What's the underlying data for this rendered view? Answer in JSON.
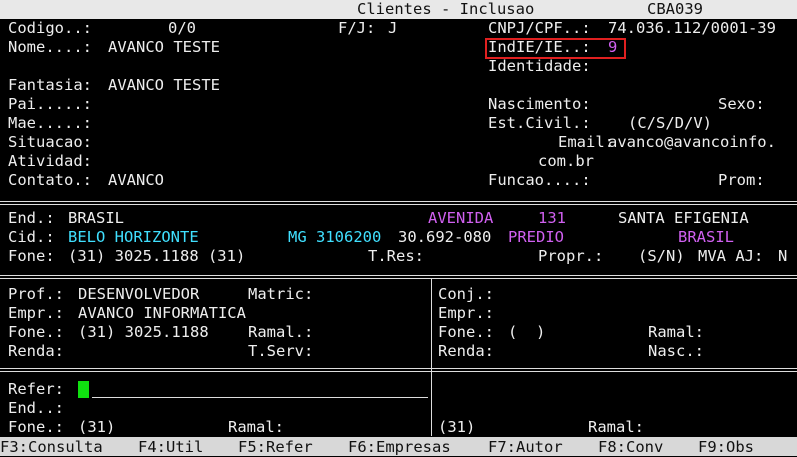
{
  "title": {
    "text": "Clientes - Inclusao",
    "code": "CBA039"
  },
  "header": {
    "codigo_label": "Codigo..:",
    "codigo_value": "0/0",
    "fj_label": "F/J:",
    "fj_value": "J",
    "cnpj_label": "CNPJ/CPF..:",
    "cnpj_value": "74.036.112/0001-39",
    "nome_label": "Nome....:",
    "nome_value": "AVANCO TESTE",
    "indie_label": "IndIE/IE..:",
    "indie_value": "9",
    "identidade_label": "Identidade:",
    "fantasia_label": "Fantasia:",
    "fantasia_value": "AVANCO TESTE",
    "pai_label": "Pai.....:",
    "nascimento_label": "Nascimento:",
    "sexo_label": "Sexo:",
    "mae_label": "Mae.....:",
    "estcivil_label": "Est.Civil.:",
    "estcivil_hint": "(C/S/D/V)",
    "situacao_label": "Situacao:",
    "email_label": "Email:",
    "email_value_1": "avanco@avancoinfo.",
    "email_value_2": "com.br",
    "atividade_label": "Atividad:",
    "contato_label": "Contato.:",
    "contato_value": "AVANCO",
    "funcao_label": "Funcao....:",
    "prom_label": "Prom:"
  },
  "address": {
    "end_label": "End.:",
    "end_value": "BRASIL",
    "tipo": "AVENIDA",
    "numero": "131",
    "bairro": "SANTA EFIGENIA",
    "cid_label": "Cid.:",
    "cid_value": "BELO HORIZONTE",
    "uf_ibge": "MG 3106200",
    "cep": "30.692-080",
    "complemento": "PREDIO",
    "pais": "BRASIL",
    "fone_label": "Fone:",
    "fone_value": "(31) 3025.1188 (31)",
    "tres_label": "T.Res:",
    "propr_label": "Propr.:",
    "propr_hint": "(S/N)",
    "mva_label": "MVA AJ:",
    "mva_value": "N"
  },
  "professional": {
    "prof_label": "Prof.:",
    "prof_value": "DESENVOLVEDOR",
    "matric_label": "Matric:",
    "empr_label": "Empr.:",
    "empr_value": "AVANCO INFORMATICA",
    "fone_label": "Fone.:",
    "fone_value": "(31) 3025.1188",
    "ramal_label": "Ramal.:",
    "renda_label": "Renda:",
    "tserv_label": "T.Serv:"
  },
  "spouse": {
    "conj_label": "Conj.:",
    "empr_label": "Empr.:",
    "fone_label": "Fone.:",
    "fone_value": "(  )",
    "ramal_label": "Ramal:",
    "renda_label": "Renda:",
    "nasc_label": "Nasc.:"
  },
  "reference": {
    "refer_label": "Refer:",
    "end_label": "End..:",
    "fone_label": "Fone.:",
    "fone_value": "(31)",
    "ramal_label": "Ramal:",
    "right_fone_value": "(31)",
    "right_ramal_label": "Ramal:"
  },
  "fkeys": [
    "F3:Consulta",
    "F4:Util",
    "F5:Refer",
    "F6:Empresas",
    "F7:Autor",
    "F8:Conv",
    "F9:Obs"
  ]
}
